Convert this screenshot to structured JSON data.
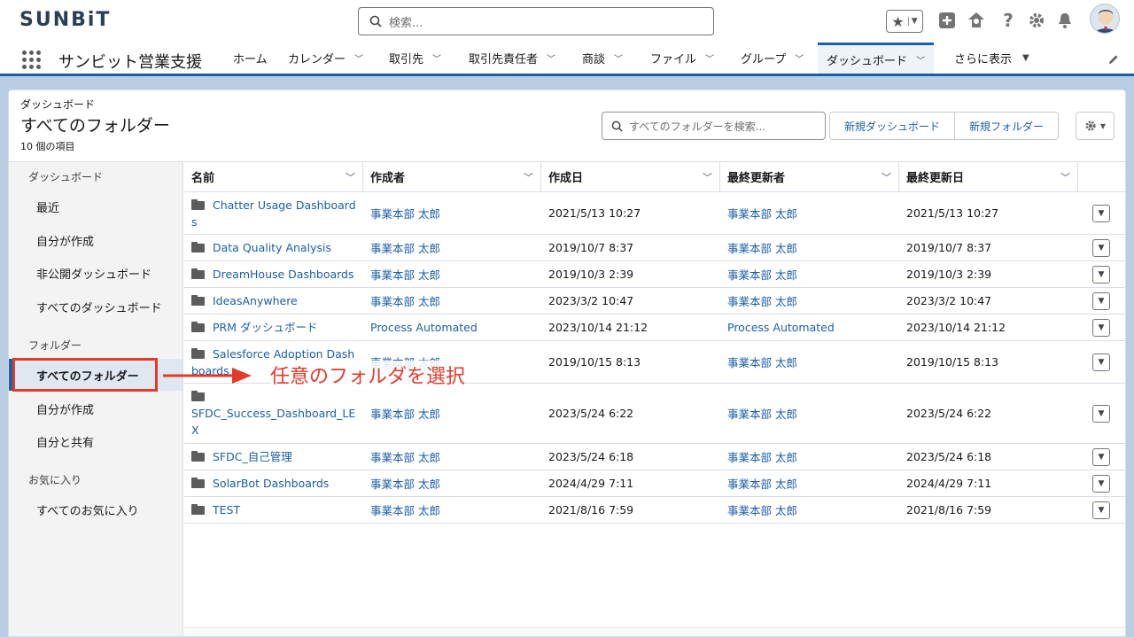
{
  "brand": {
    "logo_text": "SUNBiT"
  },
  "global_search": {
    "placeholder": "検索..."
  },
  "app": {
    "name": "サンビット営業支援"
  },
  "nav": [
    {
      "label": "ホーム",
      "has_menu": false
    },
    {
      "label": "カレンダー",
      "has_menu": true
    },
    {
      "label": "取引先",
      "has_menu": true
    },
    {
      "label": "取引先責任者",
      "has_menu": true
    },
    {
      "label": "商談",
      "has_menu": true
    },
    {
      "label": "ファイル",
      "has_menu": true
    },
    {
      "label": "グループ",
      "has_menu": true
    },
    {
      "label": "ダッシュボード",
      "has_menu": true,
      "active": true
    },
    {
      "label": "さらに表示",
      "has_menu": true
    }
  ],
  "page": {
    "object_label": "ダッシュボード",
    "title": "すべてのフォルダー",
    "item_count": "10 個の項目",
    "search_placeholder": "すべてのフォルダーを検索...",
    "new_dashboard_label": "新規ダッシュボード",
    "new_folder_label": "新規フォルダー"
  },
  "sidebar": {
    "section_dashboards": "ダッシュボード",
    "dashboards": [
      "最近",
      "自分が作成",
      "非公開ダッシュボード",
      "すべてのダッシュボード"
    ],
    "section_folders": "フォルダー",
    "folders": [
      "すべてのフォルダー",
      "自分が作成",
      "自分と共有"
    ],
    "section_favorites": "お気に入り",
    "favorites": [
      "すべてのお気に入り"
    ]
  },
  "table": {
    "columns": [
      "名前",
      "作成者",
      "作成日",
      "最終更新者",
      "最終更新日"
    ],
    "rows": [
      {
        "name": "Chatter Usage Dashboards",
        "created_by": "事業本部 太郎",
        "created": "2021/5/13 10:27",
        "modified_by": "事業本部 太郎",
        "modified": "2021/5/13 10:27"
      },
      {
        "name": "Data Quality Analysis",
        "created_by": "事業本部 太郎",
        "created": "2019/10/7 8:37",
        "modified_by": "事業本部 太郎",
        "modified": "2019/10/7 8:37"
      },
      {
        "name": "DreamHouse Dashboards",
        "created_by": "事業本部 太郎",
        "created": "2019/10/3 2:39",
        "modified_by": "事業本部 太郎",
        "modified": "2019/10/3 2:39"
      },
      {
        "name": "IdeasAnywhere",
        "created_by": "事業本部 太郎",
        "created": "2023/3/2 10:47",
        "modified_by": "事業本部 太郎",
        "modified": "2023/3/2 10:47"
      },
      {
        "name": "PRM ダッシュボード",
        "created_by": "Process Automated",
        "created": "2023/10/14 21:12",
        "modified_by": "Process Automated",
        "modified": "2023/10/14 21:12"
      },
      {
        "name": "Salesforce Adoption Dashboards",
        "created_by": "事業本部 太郎",
        "created": "2019/10/15 8:13",
        "modified_by": "事業本部 太郎",
        "modified": "2019/10/15 8:13"
      },
      {
        "name": "SFDC_Success_Dashboard_LEX",
        "created_by": "事業本部 太郎",
        "created": "2023/5/24 6:22",
        "modified_by": "事業本部 太郎",
        "modified": "2023/5/24 6:22"
      },
      {
        "name": "SFDC_自己管理",
        "created_by": "事業本部 太郎",
        "created": "2023/5/24 6:18",
        "modified_by": "事業本部 太郎",
        "modified": "2023/5/24 6:18"
      },
      {
        "name": "SolarBot Dashboards",
        "created_by": "事業本部 太郎",
        "created": "2024/4/29 7:11",
        "modified_by": "事業本部 太郎",
        "modified": "2024/4/29 7:11"
      },
      {
        "name": "TEST",
        "created_by": "事業本部 太郎",
        "created": "2021/8/16 7:59",
        "modified_by": "事業本部 太郎",
        "modified": "2021/8/16 7:59"
      }
    ]
  },
  "annotation": {
    "text": "任意のフォルダを選択",
    "color": "#e03b2a"
  },
  "colors": {
    "brand_blue": "#1b5fa8",
    "link": "#1b5fa8",
    "annotation_red": "#e03b2a"
  }
}
